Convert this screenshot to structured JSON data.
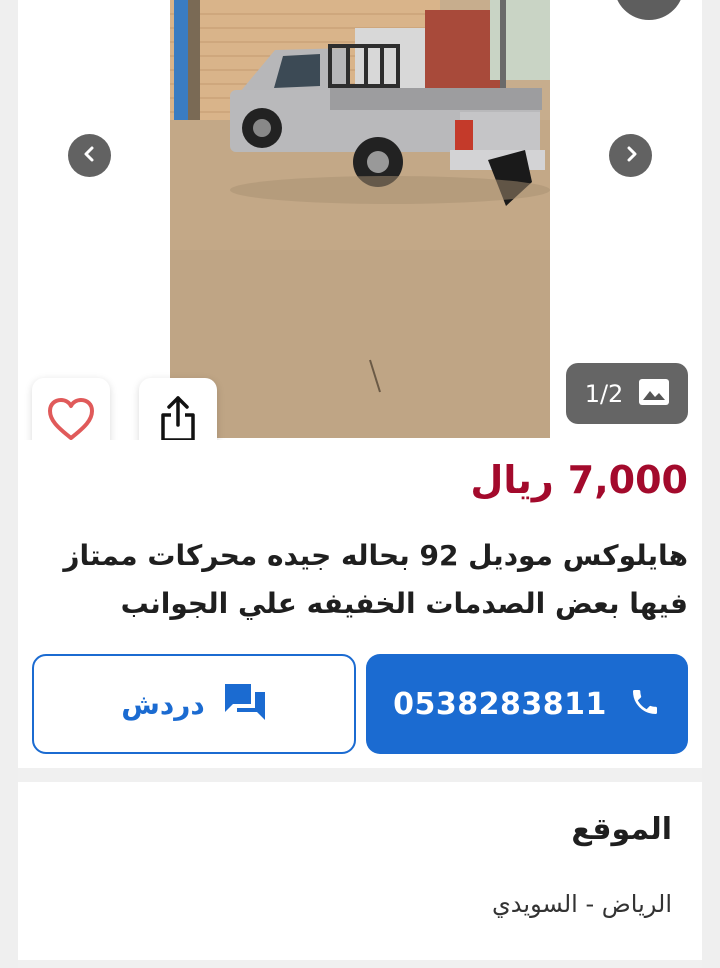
{
  "gallery": {
    "counter": "1/2",
    "icons": {
      "prev": "chevron-left-icon",
      "next": "chevron-right-icon",
      "counter": "image-icon",
      "favorite": "heart-icon",
      "share": "share-icon"
    }
  },
  "listing": {
    "price_amount": "7,000",
    "price_currency": "ريال",
    "title": "هايلوكس موديل 92 بحاله جيده محركات ممتاز فيها بعض الصدمات الخفيفه علي الجوانب"
  },
  "actions": {
    "call_number": "0538283811",
    "chat_label": "دردش",
    "call_icon": "phone-icon",
    "chat_icon": "chat-icon"
  },
  "location": {
    "heading": "الموقع",
    "value": "الرياض - السويدي"
  },
  "colors": {
    "price": "#a30a2c",
    "primary": "#1b6bd1",
    "favorite": "#e05a5a"
  }
}
